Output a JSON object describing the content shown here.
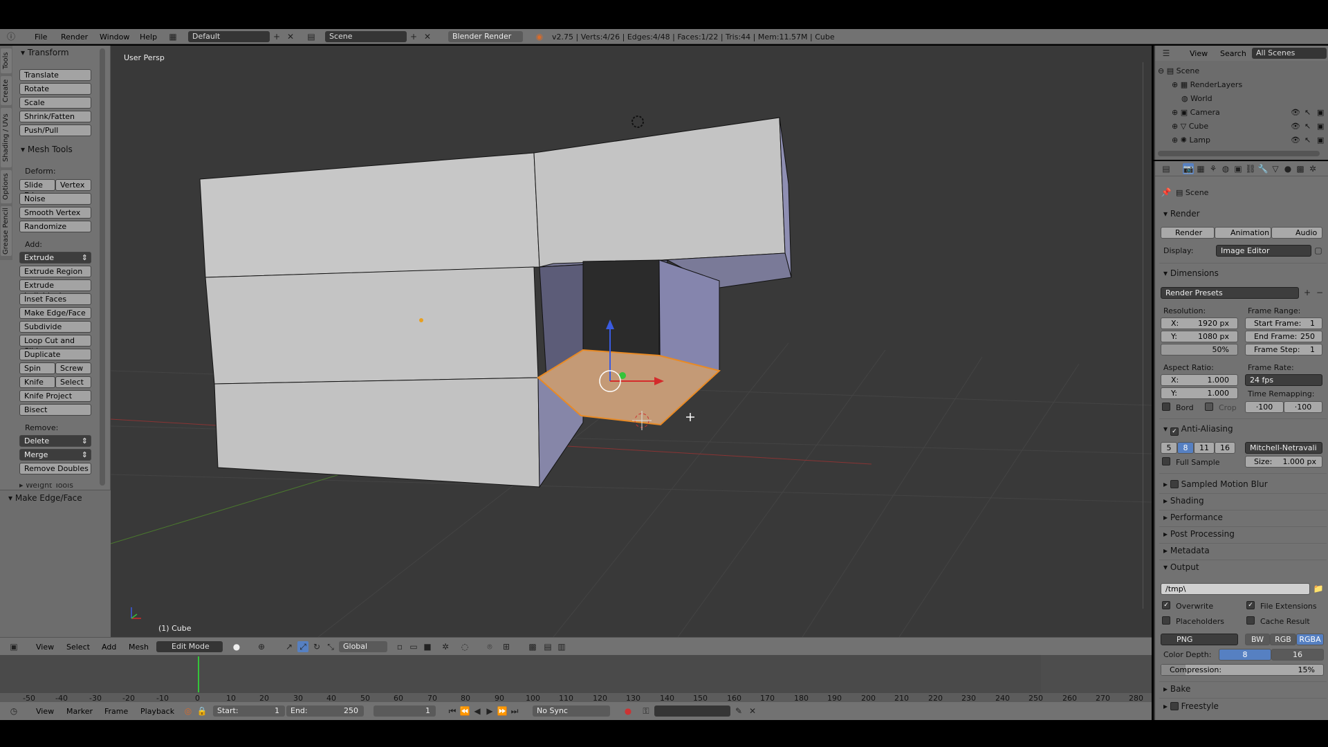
{
  "topbar": {
    "menus": [
      "File",
      "Render",
      "Window",
      "Help"
    ],
    "layout": "Default",
    "scene": "Scene",
    "engine": "Blender Render",
    "stats": "v2.75 | Verts:4/26 | Edges:4/48 | Faces:1/22 | Tris:44 | Mem:11.57M | Cube"
  },
  "toolshelf": {
    "tabs": [
      "Tools",
      "Create",
      "Shading / UVs",
      "Options",
      "Grease Pencil"
    ],
    "transform_header": "Transform",
    "transform": [
      "Translate",
      "Rotate",
      "Scale",
      "Shrink/Fatten",
      "Push/Pull"
    ],
    "mesh_tools_header": "Mesh Tools",
    "deform_label": "Deform:",
    "slide_edge": "Slide Ed",
    "vertex": "Vertex",
    "deform": [
      "Noise",
      "Smooth Vertex",
      "Randomize"
    ],
    "add_label": "Add:",
    "extrude": "Extrude",
    "add": [
      "Extrude Region",
      "Extrude Individual",
      "Inset Faces",
      "Make Edge/Face",
      "Subdivide",
      "Loop Cut and Slide",
      "Duplicate"
    ],
    "spin": "Spin",
    "screw": "Screw",
    "knife": "Knife",
    "select": "Select",
    "knife_project": "Knife Project",
    "bisect": "Bisect",
    "remove_label": "Remove:",
    "delete": "Delete",
    "merge": "Merge",
    "remove_doubles": "Remove Doubles",
    "weight_tools": "Weight Tools",
    "operator_header": "Make Edge/Face"
  },
  "viewport": {
    "view_label": "User Persp",
    "object_label": "(1) Cube"
  },
  "vpbar": {
    "menus": [
      "View",
      "Select",
      "Add",
      "Mesh"
    ],
    "mode": "Edit Mode",
    "orientation": "Global"
  },
  "timeline": {
    "ticks": [
      "-50",
      "-40",
      "-30",
      "-20",
      "-10",
      "0",
      "10",
      "20",
      "30",
      "40",
      "50",
      "60",
      "70",
      "80",
      "90",
      "100",
      "110",
      "120",
      "130",
      "140",
      "150",
      "160",
      "170",
      "180",
      "190",
      "200",
      "210",
      "220",
      "230",
      "240",
      "250",
      "260",
      "270",
      "280"
    ],
    "current_frame": 1
  },
  "tlbar": {
    "menus": [
      "View",
      "Marker",
      "Frame",
      "Playback"
    ],
    "start": "Start:",
    "start_val": "1",
    "end": "End:",
    "end_val": "250",
    "frame": "1",
    "sync": "No Sync"
  },
  "outliner": {
    "menus": [
      "View",
      "Search"
    ],
    "filter": "All Scenes",
    "items": [
      "Scene",
      "RenderLayers",
      "World",
      "Camera",
      "Cube",
      "Lamp"
    ]
  },
  "props": {
    "context": "Scene",
    "render_header": "Render",
    "render_btn": "Render",
    "animation_btn": "Animation",
    "audio_btn": "Audio",
    "display_label": "Display:",
    "display_val": "Image Editor",
    "dimensions_header": "Dimensions",
    "render_presets": "Render Presets",
    "resolution_label": "Resolution:",
    "res_x": "X:",
    "res_x_val": "1920 px",
    "res_y": "Y:",
    "res_y_val": "1080 px",
    "res_pct": "50%",
    "frame_range_label": "Frame Range:",
    "start_frame": "Start Frame:",
    "start_frame_val": "1",
    "end_frame": "End Frame:",
    "end_frame_val": "250",
    "frame_step": "Frame Step:",
    "frame_step_val": "1",
    "aspect_label": "Aspect Ratio:",
    "asp_x": "X:",
    "asp_x_val": "1.000",
    "asp_y": "Y:",
    "asp_y_val": "1.000",
    "frame_rate_label": "Frame Rate:",
    "fps": "24 fps",
    "time_remap": "Time Remapping:",
    "remap_old": "·100",
    "remap_new": "·100",
    "bord": "Bord",
    "crop": "Crop",
    "aa_header": "Anti-Aliasing",
    "aa_samples": [
      "5",
      "8",
      "11",
      "16"
    ],
    "aa_filter": "Mitchell-Netravali",
    "full_sample": "Full Sample",
    "aa_size": "Size:",
    "aa_size_val": "1.000 px",
    "collapsed1": [
      "Sampled Motion Blur",
      "Shading",
      "Performance",
      "Post Processing",
      "Metadata"
    ],
    "output_header": "Output",
    "output_path": "/tmp\\",
    "overwrite": "Overwrite",
    "file_ext": "File Extensions",
    "placeholders": "Placeholders",
    "cache_result": "Cache Result",
    "format": "PNG",
    "bw": "BW",
    "rgb": "RGB",
    "rgba": "RGBA",
    "color_depth": "Color Depth:",
    "depth8": "8",
    "depth16": "16",
    "compression": "Compression:",
    "compression_val": "15%",
    "collapsed2": [
      "Bake",
      "Freestyle"
    ]
  },
  "colors": {
    "accent": "#5680c2",
    "selected_face": "#c49a76",
    "viewport_bg": "#393939",
    "panel_bg": "#727272"
  }
}
